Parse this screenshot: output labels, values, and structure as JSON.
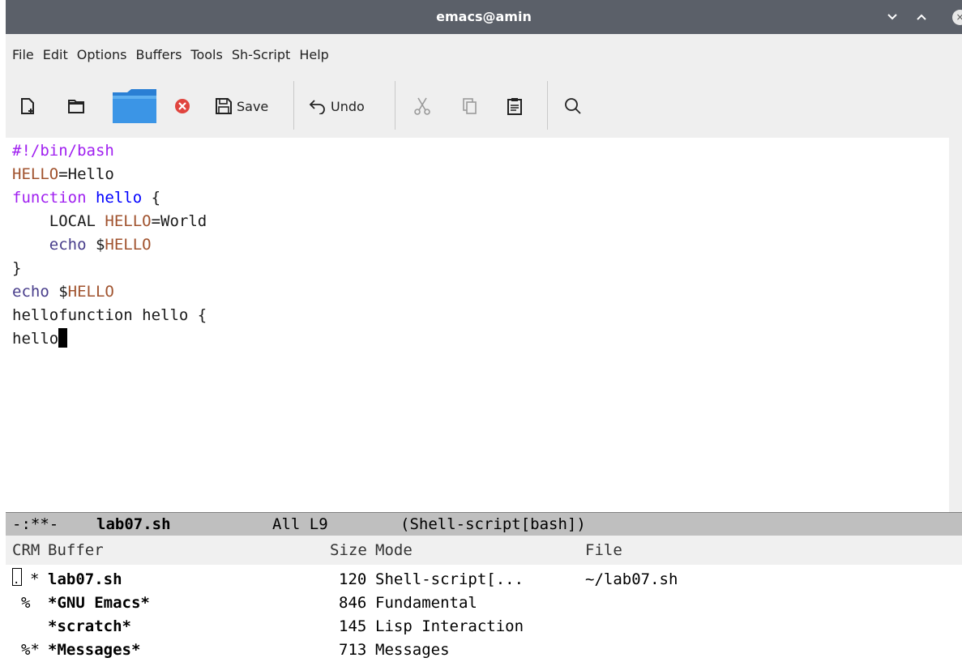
{
  "window": {
    "title": "emacs@amin"
  },
  "menu": [
    "File",
    "Edit",
    "Options",
    "Buffers",
    "Tools",
    "Sh-Script",
    "Help"
  ],
  "toolbar": {
    "save_label": "Save",
    "undo_label": "Undo"
  },
  "editor": {
    "lines": [
      "#!/bin/bash",
      "HELLO=Hello",
      "function hello {",
      "    LOCAL HELLO=World",
      "    echo $HELLO",
      "}",
      "echo $HELLO",
      "hellofunction hello {",
      "hello"
    ]
  },
  "modeline": {
    "status": "-:**-",
    "buffer": "lab07.sh",
    "position": "All L9",
    "mode": "(Shell-script[bash])"
  },
  "buffer_list": {
    "headers": {
      "crm": "CRM",
      "buffer": "Buffer",
      "size": "Size",
      "mode": "Mode",
      "file": "File"
    },
    "rows": [
      {
        "crm_mark": ".",
        "crm_mod": "*",
        "name": "lab07.sh",
        "size": "120",
        "mode": "Shell-script[...",
        "file": "~/lab07.sh"
      },
      {
        "crm_mark": "",
        "crm_mod": "%",
        "name": "*GNU Emacs*",
        "size": "846",
        "mode": "Fundamental",
        "file": ""
      },
      {
        "crm_mark": "",
        "crm_mod": "",
        "name": "*scratch*",
        "size": "145",
        "mode": "Lisp Interaction",
        "file": ""
      },
      {
        "crm_mark": "",
        "crm_mod": "%*",
        "name": "*Messages*",
        "size": "713",
        "mode": "Messages",
        "file": ""
      }
    ]
  },
  "colors": {
    "keyword": "#a020f0",
    "variable": "#a0522d",
    "builtin": "#483d8b",
    "titlebar": "#5b6069",
    "modeline": "#bfbfbf"
  }
}
